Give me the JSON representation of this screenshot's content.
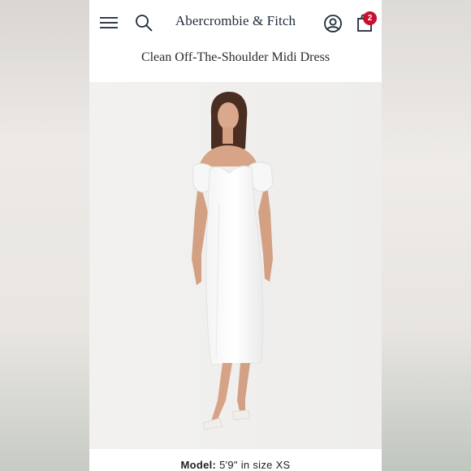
{
  "header": {
    "brand": "Abercrombie & Fitch",
    "bag_count": "2",
    "icons": [
      "menu-icon",
      "search-icon",
      "account-icon",
      "shopping-bag-icon"
    ]
  },
  "product": {
    "title": "Clean Off-The-Shoulder Midi Dress",
    "model_label": "Model:",
    "model_value": "5'9\" in size XS"
  },
  "colors": {
    "icon": "#1f2a3a",
    "badge": "#c8102e",
    "image_bg": "#f1f0ee",
    "dress": "#fdfdfd"
  }
}
